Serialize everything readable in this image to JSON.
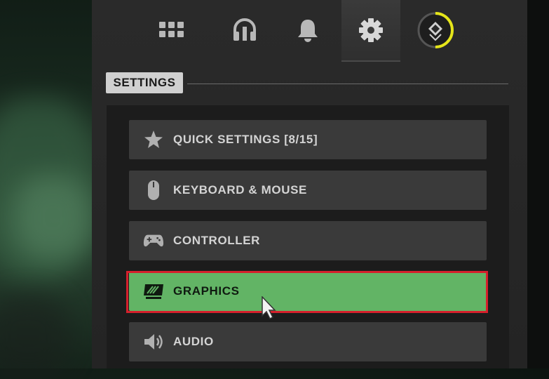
{
  "colors": {
    "accent_green": "#62b465",
    "highlight_red": "#d5202c",
    "profile_ring": "#e5e51a"
  },
  "tabs": [
    {
      "name": "grid",
      "icon": "grid-icon"
    },
    {
      "name": "social",
      "icon": "headset-icon"
    },
    {
      "name": "notifications",
      "icon": "bell-icon"
    },
    {
      "name": "settings",
      "icon": "gear-icon",
      "active": true
    },
    {
      "name": "profile",
      "icon": "rank-emblem-icon"
    }
  ],
  "section": {
    "title": "SETTINGS"
  },
  "menu": [
    {
      "label": "QUICK SETTINGS [8/15]",
      "icon": "star-icon"
    },
    {
      "label": "KEYBOARD & MOUSE",
      "icon": "mouse-icon"
    },
    {
      "label": "CONTROLLER",
      "icon": "gamepad-icon"
    },
    {
      "label": "GRAPHICS",
      "icon": "monitor-icon",
      "selected": true
    },
    {
      "label": "AUDIO",
      "icon": "speaker-icon"
    }
  ]
}
